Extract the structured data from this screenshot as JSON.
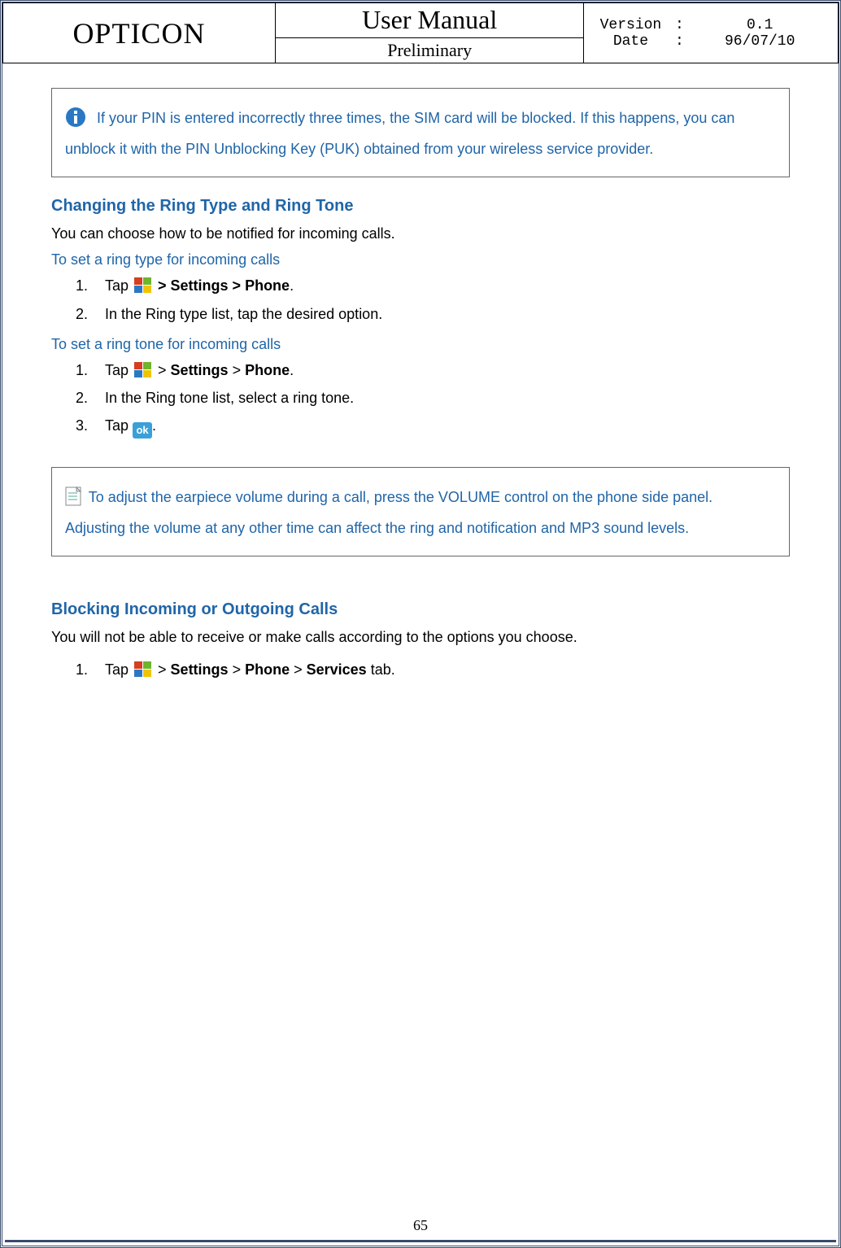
{
  "header": {
    "brand": "OPTICON",
    "title": "User Manual",
    "subtitle": "Preliminary",
    "version_label": "Version",
    "version_value": "0.1",
    "date_label": "Date",
    "date_value": "96/07/10"
  },
  "note1": {
    "text": "If your PIN is entered incorrectly three times, the SIM card will be blocked. If this happens, you can unblock it with the PIN Unblocking Key (PUK) obtained from your wireless service provider."
  },
  "section1": {
    "heading": "Changing the Ring Type and Ring Tone",
    "intro": "You can choose how to be notified for incoming calls.",
    "sub1": "To set a ring type for incoming calls",
    "steps1": {
      "s1_pre": "Tap ",
      "s1_post": " > Settings > Phone",
      "s1_end": ".",
      "s2": "In the Ring type list, tap the desired option."
    },
    "sub2": "To set a ring tone for incoming calls",
    "steps2": {
      "s1_pre": "Tap ",
      "s1_mid1": " > ",
      "s1_b1": "Settings",
      "s1_mid2": " > ",
      "s1_b2": "Phone",
      "s1_end": ".",
      "s2": "In the Ring tone list, select a ring tone.",
      "s3_pre": "Tap ",
      "s3_end": "."
    }
  },
  "note2": {
    "text_pre": "To adjust the earpiece volume during a call, press the VOLUME control on the phone side panel. Adjusting the volume at any other time can affect the ring and notification ",
    "text_and": "and MP3",
    "text_post": " sound levels."
  },
  "section2": {
    "heading": "Blocking Incoming or Outgoing Calls",
    "intro": "You will not be able to receive or make calls according to the options you choose.",
    "steps": {
      "s1_pre": "Tap ",
      "s1_mid1": " > ",
      "s1_b1": "Settings",
      "s1_mid2": " > ",
      "s1_b2": "Phone",
      "s1_mid3": " > ",
      "s1_b3": "Services",
      "s1_post": " tab."
    }
  },
  "ok_label": "ok",
  "page_number": "65"
}
